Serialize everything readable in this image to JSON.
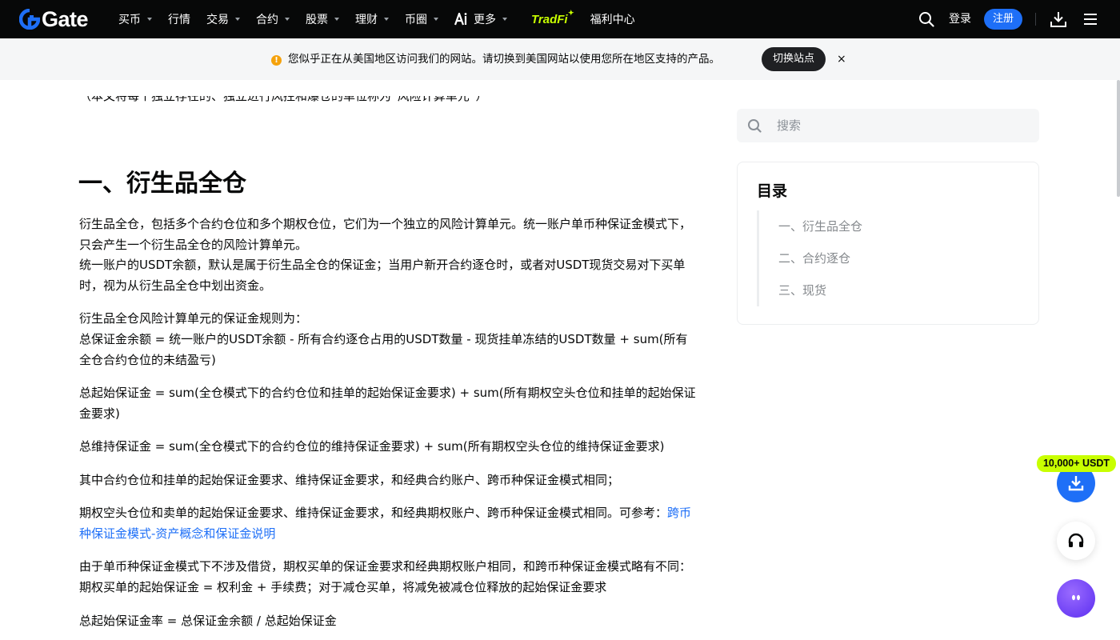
{
  "nav": {
    "logo_text": "Gate",
    "items": [
      {
        "label": "买币",
        "has_caret": true
      },
      {
        "label": "行情",
        "has_caret": false
      },
      {
        "label": "交易",
        "has_caret": true
      },
      {
        "label": "合约",
        "has_caret": true
      },
      {
        "label": "股票",
        "has_caret": true
      },
      {
        "label": "理财",
        "has_caret": true
      },
      {
        "label": "币圈",
        "has_caret": true
      },
      {
        "label": "更多",
        "has_caret": true,
        "icon": "ai-icon"
      }
    ],
    "tradfi": "TradFi",
    "welfare": "福利中心",
    "login": "登录",
    "register": "注册",
    "accent": "#1e6ff7",
    "brand_green": "#c8ff00"
  },
  "banner": {
    "message": "您似乎正在从美国地区访问我们的网站。请切换到美国网站以使用您所在地区支持的产品。",
    "switch_label": "切换站点",
    "close": "×",
    "warn_icon": "!"
  },
  "article": {
    "clipped_intro": "（本文将每个独立存在的、独立进行风控和爆仓的单位称为“风险计算单元”）",
    "section_title": "一、衍生品全仓",
    "paragraphs": [
      "衍生品全仓，包括多个合约仓位和多个期权仓位，它们为一个独立的风险计算单元。统一账户单币种保证金模式下，只会产生一个衍生品全仓的风险计算单元。",
      "统一账户的USDT余额，默认是属于衍生品全仓的保证金；当用户新开合约逐仓时，或者对USDT现货交易对下买单时，视为从衍生品全仓中划出资金。",
      "衍生品全仓风险计算单元的保证金规则为：",
      "总保证金余额 = 统一账户的USDT余额 - 所有合约逐仓占用的USDT数量 - 现货挂单冻结的USDT数量 + sum(所有全仓合约仓位的未结盈亏)",
      "总起始保证金 = sum(全仓模式下的合约仓位和挂单的起始保证金要求) + sum(所有期权空头仓位和挂单的起始保证金要求)",
      "总维持保证金 = sum(全仓模式下的合约仓位的维持保证金要求) + sum(所有期权空头仓位的维持保证金要求)",
      "其中合约仓位和挂单的起始保证金要求、维持保证金要求，和经典合约账户、跨币种保证金模式相同；",
      "期权空头仓位和卖单的起始保证金要求、维持保证金要求，和经典期权账户、跨币种保证金模式相同。可参考：",
      "由于单币种保证金模式下不涉及借贷，期权买单的保证金要求和经典期权账户相同，和跨币种保证金模式略有不同：期权买单的起始保证金 = 权利金 + 手续费；对于减仓买单，将减免被减仓位释放的起始保证金要求",
      "总起始保证金率 = 总保证金余额 / 总起始保证金"
    ],
    "reference_link": "跨币种保证金模式-资产概念和保证金说明"
  },
  "sidebar": {
    "search_placeholder": "搜索",
    "toc_title": "目录",
    "toc_items": [
      "一、衍生品全仓",
      "二、合约逐仓",
      "三、现货"
    ]
  },
  "floating": {
    "promo": "10,000+ USDT",
    "download_icon": "download-icon",
    "support_icon": "headset-icon",
    "bot_icon": "chatbot-icon"
  }
}
